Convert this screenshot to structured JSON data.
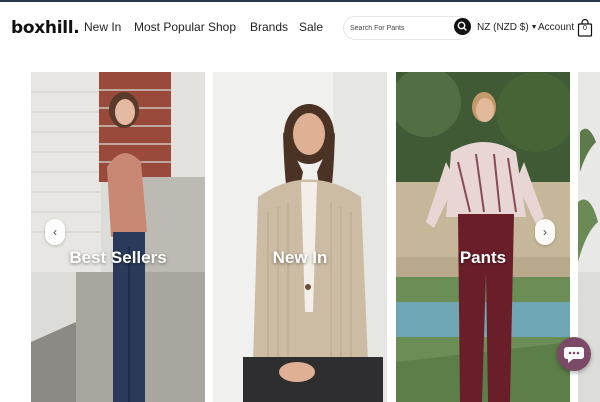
{
  "header": {
    "logo": "boxhill.",
    "nav": [
      "New In",
      "Most Popular",
      "Shop",
      "Brands",
      "Sale"
    ],
    "search_placeholder": "Search For Pants",
    "currency": "NZ (NZD $)",
    "account": "Account",
    "cart_count": "0"
  },
  "carousel": {
    "cards": [
      {
        "title": "Best Sellers"
      },
      {
        "title": "New In"
      },
      {
        "title": "Pants"
      }
    ],
    "prev_icon": "chevron-left-icon",
    "next_icon": "chevron-right-icon"
  },
  "colors": {
    "header_line": "#2a3a4a",
    "search_button": "#111111",
    "chat_button": "#7a4a66"
  }
}
